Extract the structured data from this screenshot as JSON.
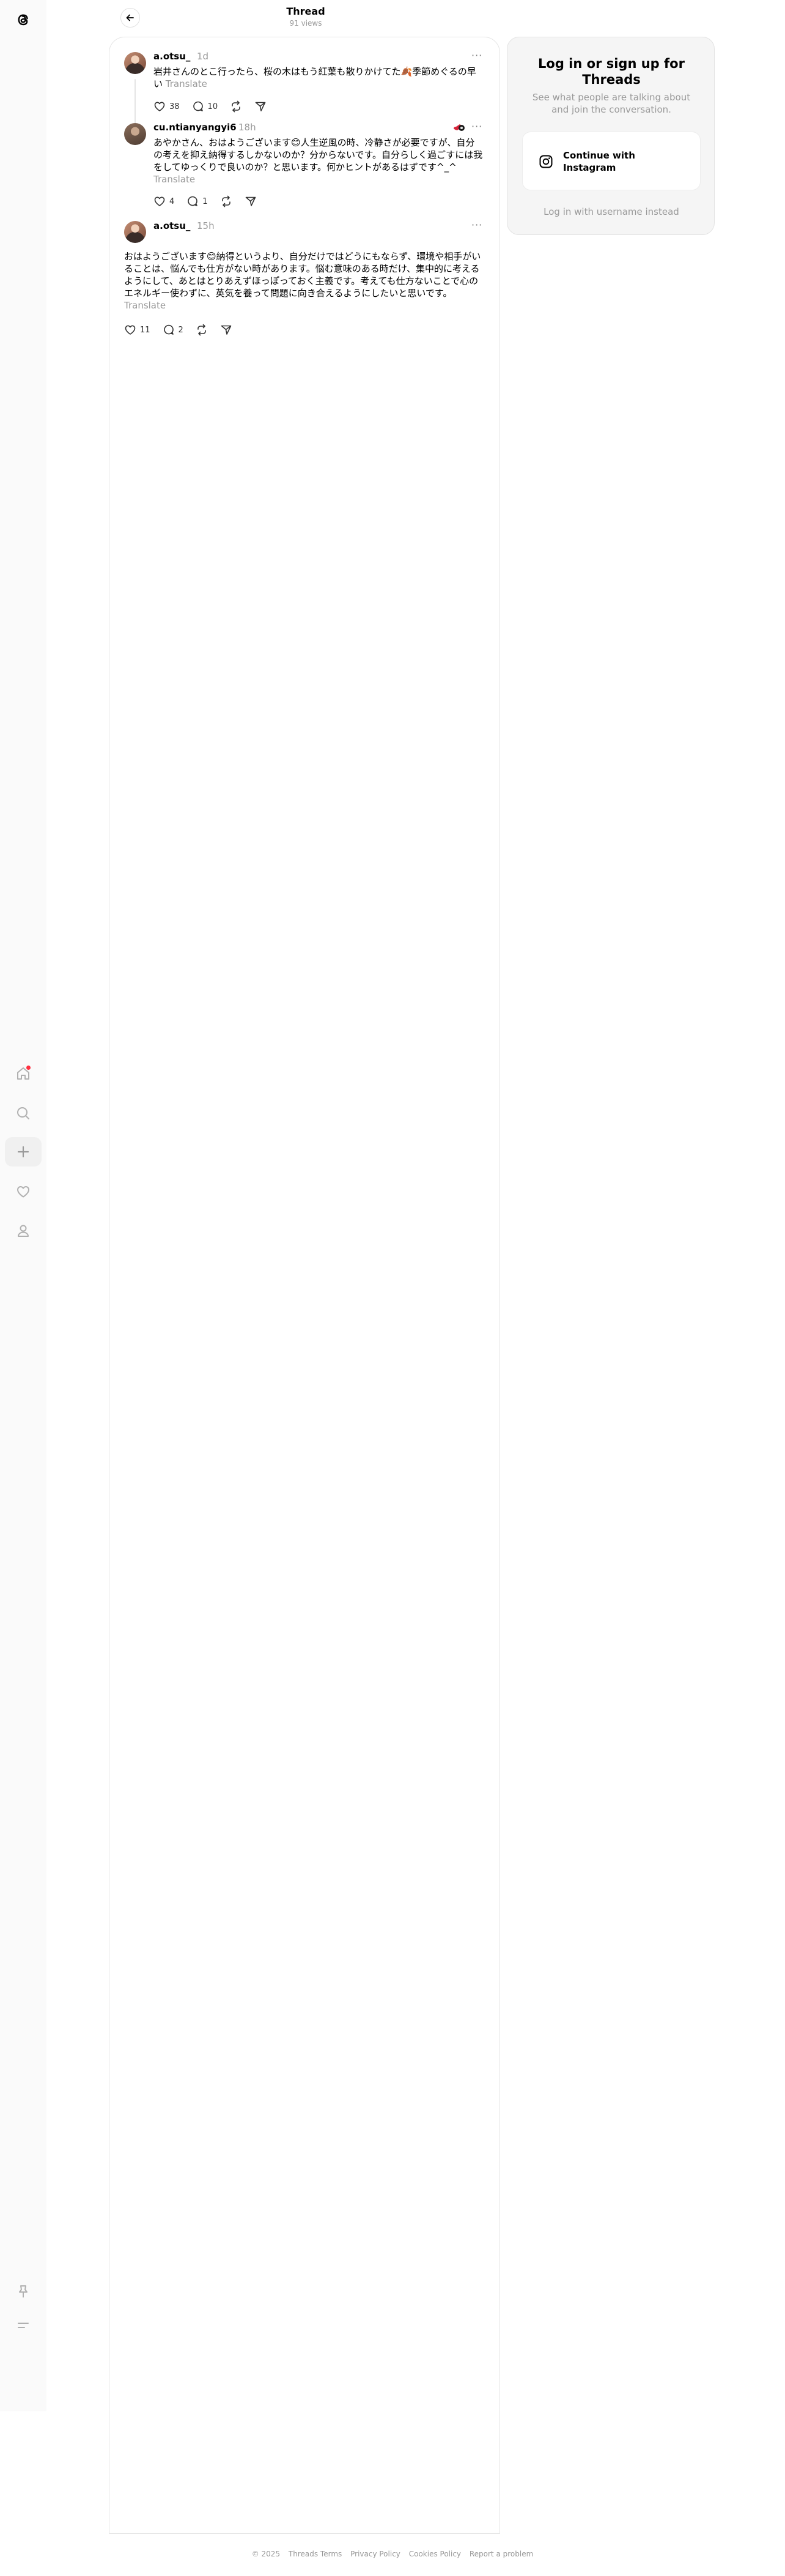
{
  "header": {
    "title": "Thread",
    "views": "91 views"
  },
  "posts": [
    {
      "username": "a.otsu_",
      "time": "1d",
      "text": "岩井さんのとこ行ったら、桜の木はもう紅葉も散りかけてた🍂季節めぐるの早い",
      "translate": "Translate",
      "likes": "38",
      "replies": "10"
    },
    {
      "username": "cu.ntianyangyi6",
      "time": "18h",
      "text": "あやかさん、おはようございます😊人生逆風の時、冷静さが必要ですが、自分の考えを抑え納得するしかないのか？分からないです。自分らしく過ごすには我をしてゆっくりで良いのか？と思います。何かヒントがあるはずです^_^",
      "translate": "Translate",
      "likes": "4",
      "replies": "1"
    },
    {
      "username": "a.otsu_",
      "time": "15h",
      "text": "おはようございます😊納得というより、自分だけではどうにもならず、環境や相手がいることは、悩んでも仕方がない時があります。悩む意味のある時だけ、集中的に考えるようにして、あとはとりあえずほっぽっておく主義です。考えても仕方ないことで心のエネルギー使わずに、英気を養って問題に向き合えるようにしたいと思いです。",
      "translate": "Translate",
      "likes": "11",
      "replies": "2"
    }
  ],
  "login": {
    "title": "Log in or sign up for Threads",
    "subtitle": "See what people are talking about and join the conversation.",
    "instagram_button": "Continue with Instagram",
    "alt": "Log in with username instead"
  },
  "footer": [
    "© 2025",
    "Threads Terms",
    "Privacy Policy",
    "Cookies Policy",
    "Report a problem"
  ],
  "colors": {
    "notification": "#ff3040",
    "muted": "#999999",
    "rail_bg": "#fafafa"
  },
  "icons": [
    "threads-logo-icon",
    "home-icon",
    "search-icon",
    "plus-icon",
    "heart-icon",
    "profile-icon",
    "pin-icon",
    "menu-icon",
    "arrow-left-icon",
    "like-icon",
    "reply-icon",
    "repost-icon",
    "share-icon",
    "more-icon",
    "instagram-icon"
  ]
}
